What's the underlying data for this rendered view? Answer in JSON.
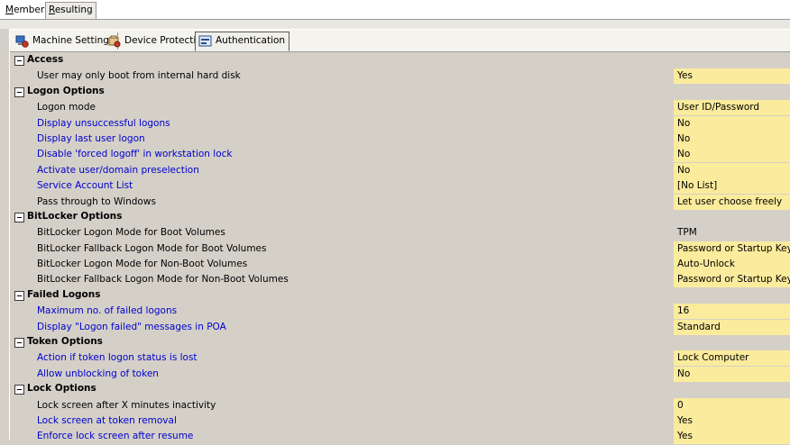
{
  "top_tabs": [
    {
      "pre": "",
      "u": "M",
      "post": "embers"
    },
    {
      "pre": "",
      "u": "R",
      "post": "esulting"
    }
  ],
  "sub_tabs": [
    {
      "label": "Machine Settings",
      "icon": "machine-settings-icon"
    },
    {
      "label": "Device Protection",
      "icon": "device-protection-icon"
    },
    {
      "label": "Authentication",
      "icon": "authentication-icon"
    }
  ],
  "sections": [
    {
      "title": "Access",
      "items": [
        {
          "label": "User may only boot from internal hard disk",
          "value": "Yes",
          "link": false,
          "plain": false
        }
      ]
    },
    {
      "title": "Logon Options",
      "items": [
        {
          "label": "Logon mode",
          "value": "User ID/Password",
          "link": false,
          "plain": false
        },
        {
          "label": "Display unsuccessful logons",
          "value": "No",
          "link": true,
          "plain": false
        },
        {
          "label": "Display last user logon",
          "value": "No",
          "link": true,
          "plain": false
        },
        {
          "label": "Disable 'forced logoff' in workstation lock",
          "value": "No",
          "link": true,
          "plain": false
        },
        {
          "label": "Activate user/domain preselection",
          "value": "No",
          "link": true,
          "plain": false
        },
        {
          "label": "Service Account List",
          "value": "[No List]",
          "link": true,
          "plain": false
        },
        {
          "label": "Pass through to Windows",
          "value": "Let user choose freely",
          "link": false,
          "plain": false
        }
      ]
    },
    {
      "title": "BitLocker Options",
      "items": [
        {
          "label": "BitLocker Logon Mode for Boot Volumes",
          "value": "TPM",
          "link": false,
          "plain": true
        },
        {
          "label": "BitLocker Fallback Logon Mode for Boot Volumes",
          "value": "Password or Startup Key",
          "link": false,
          "plain": false
        },
        {
          "label": "BitLocker Logon Mode for Non-Boot Volumes",
          "value": "Auto-Unlock",
          "link": false,
          "plain": false
        },
        {
          "label": "BitLocker Fallback Logon Mode for Non-Boot Volumes",
          "value": "Password or Startup Key",
          "link": false,
          "plain": false
        }
      ]
    },
    {
      "title": "Failed Logons",
      "items": [
        {
          "label": "Maximum no. of failed logons",
          "value": "16",
          "link": true,
          "plain": false
        },
        {
          "label": "Display \"Logon failed\" messages in POA",
          "value": "Standard",
          "link": true,
          "plain": false
        }
      ]
    },
    {
      "title": "Token Options",
      "items": [
        {
          "label": "Action if token logon status is lost",
          "value": "Lock Computer",
          "link": true,
          "plain": false
        },
        {
          "label": "Allow unblocking of token",
          "value": "No",
          "link": true,
          "plain": false
        }
      ]
    },
    {
      "title": "Lock Options",
      "items": [
        {
          "label": "Lock screen after X minutes inactivity",
          "value": "0",
          "link": false,
          "plain": false
        },
        {
          "label": "Lock screen at token removal",
          "value": "Yes",
          "link": true,
          "plain": false
        },
        {
          "label": "Enforce lock screen after resume",
          "value": "Yes",
          "link": true,
          "plain": false
        }
      ]
    }
  ],
  "colors": {
    "link": "#0000cc",
    "value_bg": "#fbeb9c",
    "panel_bg": "#d4d0c8"
  }
}
